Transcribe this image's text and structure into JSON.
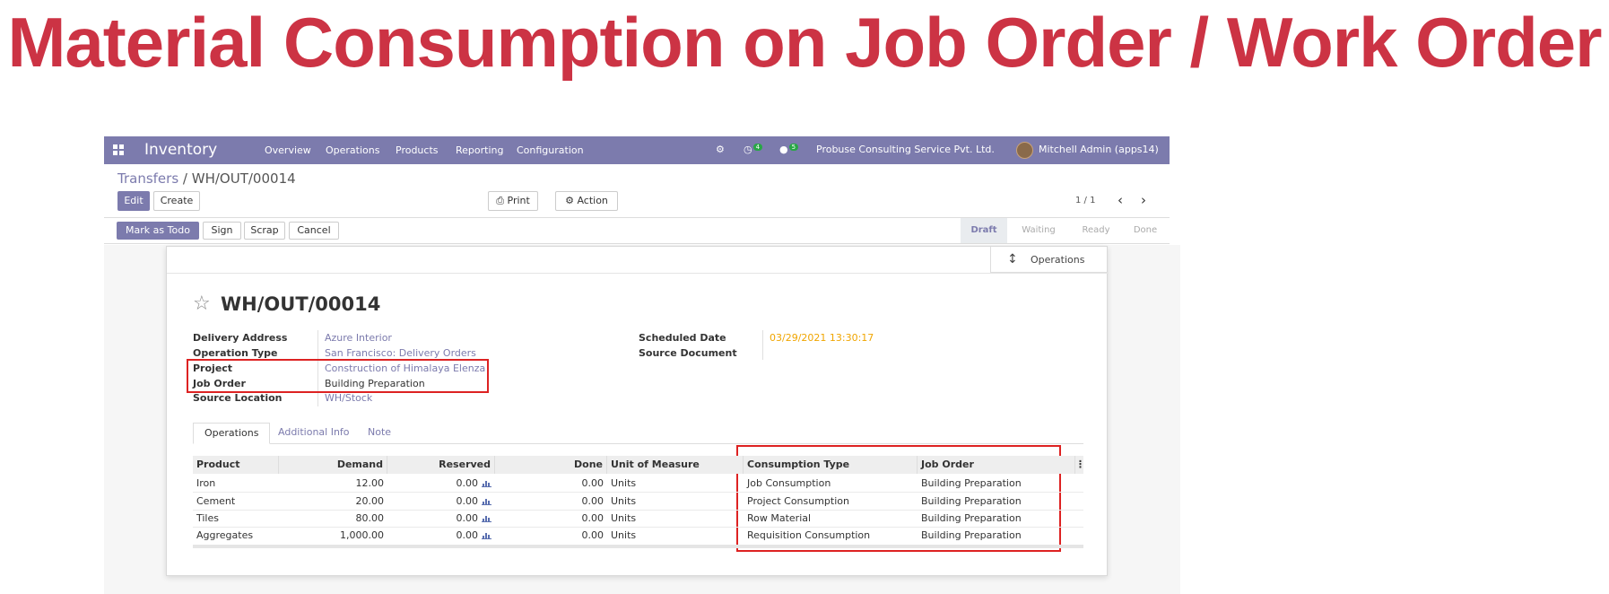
{
  "banner": {
    "title": "Material Consumption on Job Order / Work Order"
  },
  "topbar": {
    "app_name": "Inventory",
    "menu": [
      "Overview",
      "Operations",
      "Products",
      "Reporting",
      "Configuration"
    ],
    "activity_count": "4",
    "message_count": "5",
    "company": "Probuse Consulting Service Pvt. Ltd.",
    "user": "Mitchell Admin (apps14)"
  },
  "breadcrumb": {
    "parent": "Transfers",
    "separator": "/",
    "current": "WH/OUT/00014"
  },
  "controls": {
    "edit": "Edit",
    "create": "Create",
    "print": "Print",
    "action": "Action",
    "pager": "1 / 1"
  },
  "statusbar": {
    "buttons": [
      "Mark as Todo",
      "Sign",
      "Scrap",
      "Cancel"
    ],
    "stages": [
      "Draft",
      "Waiting",
      "Ready",
      "Done"
    ],
    "active_stage": "Draft"
  },
  "form": {
    "smart_button": "Operations",
    "name": "WH/OUT/00014",
    "left_fields": [
      {
        "label": "Delivery Address",
        "value": "Azure Interior"
      },
      {
        "label": "Operation Type",
        "value": "San Francisco: Delivery Orders"
      },
      {
        "label": "Project",
        "value": "Construction of Himalaya Elenza"
      },
      {
        "label": "Job Order",
        "value": "Building Preparation"
      },
      {
        "label": "Source Location",
        "value": "WH/Stock"
      }
    ],
    "right_fields": [
      {
        "label": "Scheduled Date",
        "value": "03/29/2021 13:30:17"
      },
      {
        "label": "Source Document",
        "value": ""
      }
    ],
    "tabs": [
      "Operations",
      "Additional Info",
      "Note"
    ],
    "active_tab": "Operations"
  },
  "table": {
    "headers": [
      "Product",
      "Demand",
      "Reserved",
      "Done",
      "Unit of Measure",
      "Consumption Type",
      "Job Order"
    ],
    "rows": [
      [
        "Iron",
        "12.00",
        "0.00",
        "0.00",
        "Units",
        "Job Consumption",
        "Building Preparation"
      ],
      [
        "Cement",
        "20.00",
        "0.00",
        "0.00",
        "Units",
        "Project Consumption",
        "Building Preparation"
      ],
      [
        "Tiles",
        "80.00",
        "0.00",
        "0.00",
        "Units",
        "Row Material",
        "Building Preparation"
      ],
      [
        "Aggregates",
        "1,000.00",
        "0.00",
        "0.00",
        "Units",
        "Requisition Consumption",
        "Building Preparation"
      ]
    ]
  },
  "colors": {
    "brand": "#7c7bad",
    "banner": "#cc3344",
    "highlight": "#dd2222",
    "date": "#f0a500"
  }
}
